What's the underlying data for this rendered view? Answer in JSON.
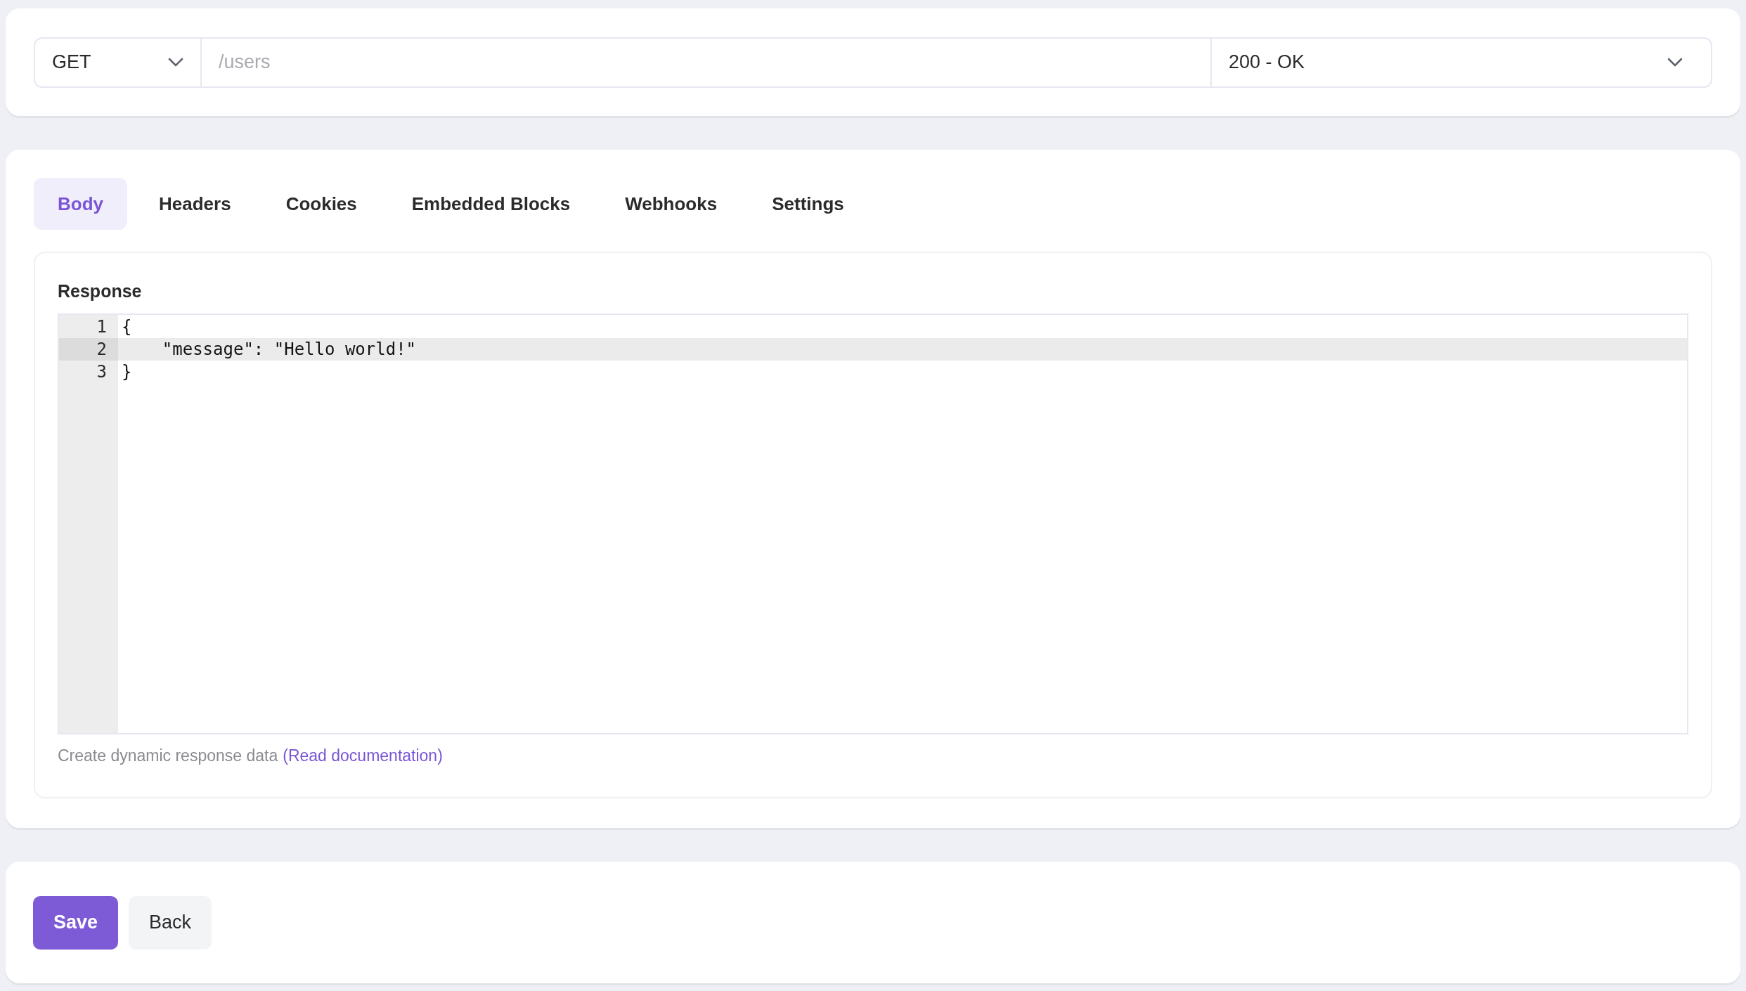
{
  "request": {
    "method": "GET",
    "path_placeholder": "/users",
    "status": "200 - OK"
  },
  "tabs": [
    {
      "label": "Body",
      "selected": true
    },
    {
      "label": "Headers",
      "selected": false
    },
    {
      "label": "Cookies",
      "selected": false
    },
    {
      "label": "Embedded Blocks",
      "selected": false
    },
    {
      "label": "Webhooks",
      "selected": false
    },
    {
      "label": "Settings",
      "selected": false
    }
  ],
  "response": {
    "label": "Response",
    "lines": [
      {
        "number": "1",
        "text": "{",
        "active": false
      },
      {
        "number": "2",
        "text": "    \"message\": \"Hello world!\"",
        "active": true
      },
      {
        "number": "3",
        "text": "}",
        "active": false
      }
    ],
    "hint": "Create dynamic response data",
    "hint_link": "(Read documentation)"
  },
  "buttons": [
    {
      "label": "Save",
      "kind": "primary"
    },
    {
      "label": "Back",
      "kind": "secondary"
    }
  ]
}
